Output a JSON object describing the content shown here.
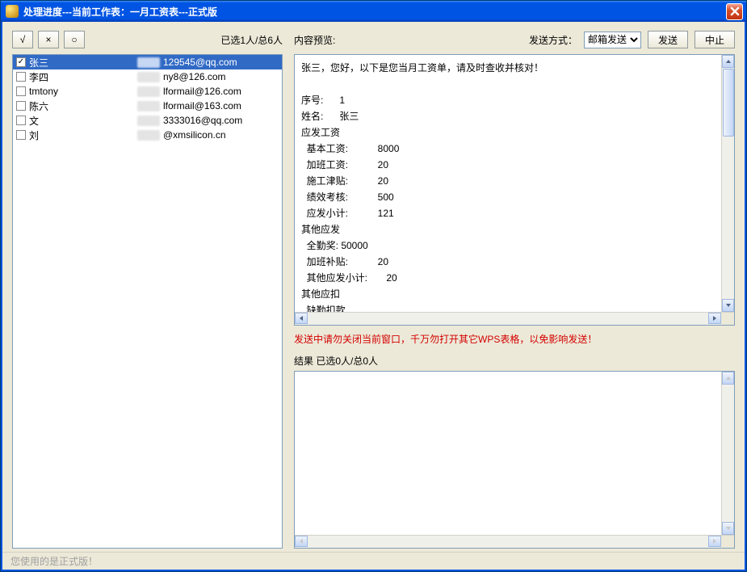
{
  "window": {
    "title": "处理进度---当前工作表：一月工资表---正式版"
  },
  "left": {
    "btn_check": "√",
    "btn_uncheck": "×",
    "btn_circle": "○",
    "selection_count": "已选1人/总6人",
    "rows": [
      {
        "checked": true,
        "selected": true,
        "name": "张三",
        "email": "129545@qq.com"
      },
      {
        "checked": false,
        "selected": false,
        "name": "李四",
        "email": "ny8@126.com"
      },
      {
        "checked": false,
        "selected": false,
        "name": "tmtony",
        "email": "lformail@126.com"
      },
      {
        "checked": false,
        "selected": false,
        "name": "陈六",
        "email": "lformail@163.com"
      },
      {
        "checked": false,
        "selected": false,
        "name": "文",
        "email": "3333016@qq.com"
      },
      {
        "checked": false,
        "selected": false,
        "name": "刘",
        "email": "@xmsilicon.cn"
      }
    ]
  },
  "right": {
    "preview_label": "内容预览:",
    "send_method_label": "发送方式：",
    "send_method_selected": "邮箱发送",
    "send_button": "发送",
    "stop_button": "中止",
    "preview_text": "张三，您好，以下是您当月工资单，请及时查收并核对！\n\n序号:      1\n姓名:      张三\n应发工资        \n  基本工资:           8000\n  加班工资:           20\n  施工津贴:           20\n  绩效考核:           500\n  应发小计:           121\n其他应发        \n  全勤奖: 50000\n  加班补贴:           20\n  其他应发小计:       20\n其他应扣        \n  缺勤扣款",
    "warning": "发送中请勿关闭当前窗口，千万勿打开其它WPS表格，以免影响发送！",
    "result_label": "结果   已选0人/总0人"
  },
  "status": {
    "text": "您使用的是正式版！"
  }
}
